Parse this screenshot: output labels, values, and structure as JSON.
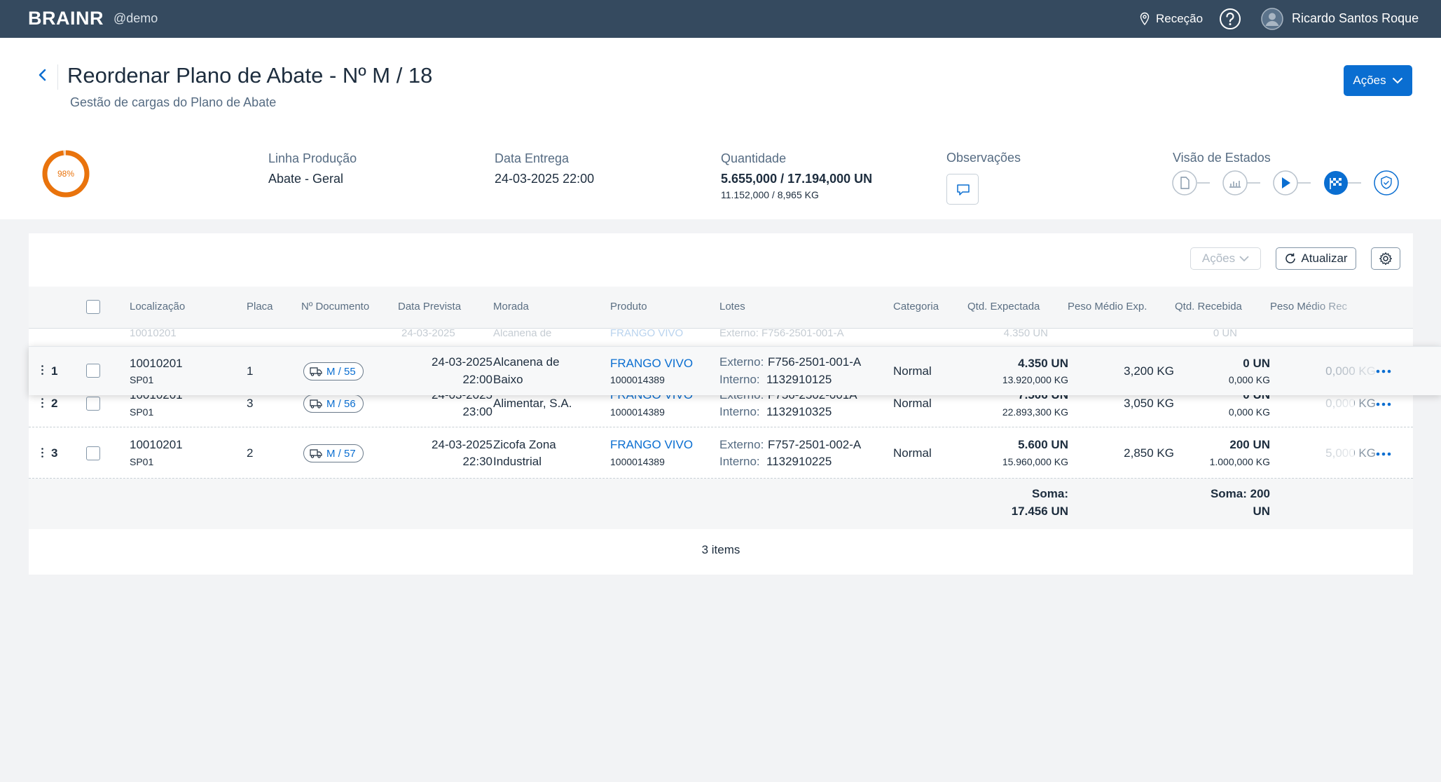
{
  "shell": {
    "logo": "BRAINR",
    "tenant": "@demo",
    "location": "Receção",
    "user_name": "Ricardo Santos Roque"
  },
  "header": {
    "title": "Reordenar Plano de Abate - Nº M / 18",
    "subtitle": "Gestão de cargas do Plano de Abate",
    "actions_label": "Ações",
    "progress_label": "98%",
    "progress_value": 98,
    "kpis": {
      "linha_label": "Linha Produção",
      "linha_value": "Abate - Geral",
      "entrega_label": "Data Entrega",
      "entrega_value": "24-03-2025 22:00",
      "quantidade_label": "Quantidade",
      "quantidade_value": "5.655,000 / 17.194,000 UN",
      "quantidade_kg": "11.152,000 / 8,965 KG",
      "observacoes_label": "Observações",
      "estados_label": "Visão de Estados"
    }
  },
  "toolbar": {
    "acoes_label": "Ações",
    "atualizar_label": "Atualizar"
  },
  "columns": {
    "localizacao": "Localização",
    "placa": "Placa",
    "documento": "Nº Documento",
    "data_prevista": "Data Prevista",
    "morada": "Morada",
    "produto": "Produto",
    "lotes": "Lotes",
    "categoria": "Categoria",
    "qtd_expectada": "Qtd. Expectada",
    "peso_medio_exp": "Peso Médio Exp.",
    "qtd_recebida": "Qtd. Recebida",
    "peso_medio_rec": "Peso Médio Rec"
  },
  "rows": [
    {
      "index": "1",
      "loc": "10010201",
      "loc_sub": "SP01",
      "placa": "1",
      "doc": "M / 55",
      "date": "24-03-2025",
      "time": "22:00",
      "morada_1": "Alcanena de",
      "morada_2": "Baixo",
      "produto": "FRANGO VIVO",
      "produto_code": "1000014389",
      "externo_label": "Externo:",
      "externo": "F756-2501-001-A",
      "interno_label": "Interno:",
      "interno": "1132910125",
      "categoria": "Normal",
      "qtd_exp": "4.350 UN",
      "qtd_exp_kg": "13.920,000 KG",
      "peso_exp": "3,200 KG",
      "qtd_rec": "0 UN",
      "qtd_rec_kg": "0,000 KG",
      "peso_rec": "0,000 KG"
    },
    {
      "index": "2",
      "loc": "10010201",
      "loc_sub": "SP01",
      "placa": "3",
      "doc": "M / 56",
      "date": "24-03-2025",
      "time": "23:00",
      "morada_1": "Alimentar, S.A.",
      "produto": "FRANGO VIVO",
      "produto_code": "1000014389",
      "externo_label": "Externo:",
      "externo": "F756-2502-001A",
      "interno_label": "Interno:",
      "interno": "1132910325",
      "categoria": "Normal",
      "qtd_exp": "7.506 UN",
      "qtd_exp_kg": "22.893,300 KG",
      "peso_exp": "3,050 KG",
      "qtd_rec": "0 UN",
      "qtd_rec_kg": "0,000 KG",
      "peso_rec": "0,000 KG"
    },
    {
      "index": "3",
      "loc": "10010201",
      "loc_sub": "SP01",
      "placa": "2",
      "doc": "M / 57",
      "date": "24-03-2025",
      "time": "22:30",
      "morada_1": "Zicofa Zona",
      "morada_2": "Industrial",
      "produto": "FRANGO VIVO",
      "produto_code": "1000014389",
      "externo_label": "Externo:",
      "externo": "F757-2501-002-A",
      "interno_label": "Interno:",
      "interno": "1132910225",
      "categoria": "Normal",
      "qtd_exp": "5.600 UN",
      "qtd_exp_kg": "15.960,000 KG",
      "peso_exp": "2,850 KG",
      "qtd_rec": "200 UN",
      "qtd_rec_kg": "1.000,000 KG",
      "peso_rec": "5,000 KG"
    }
  ],
  "ghost": {
    "loc": "10010201",
    "date": "24-03-2025",
    "morada": "Alcanena de",
    "produto": "FRANGO VIVO",
    "externo": "Externo: F756-2501-001-A",
    "qtd": "4.350 UN",
    "rec": "0 UN"
  },
  "summary": {
    "exp_label": "Soma:",
    "exp_value": "17.456 UN",
    "rec_label": "Soma: 200",
    "rec_value": "UN"
  },
  "footer": {
    "items": "3 items"
  },
  "colors": {
    "shell": "#354a5f",
    "accent": "#0a6ed1",
    "progress": "#e9730c"
  }
}
